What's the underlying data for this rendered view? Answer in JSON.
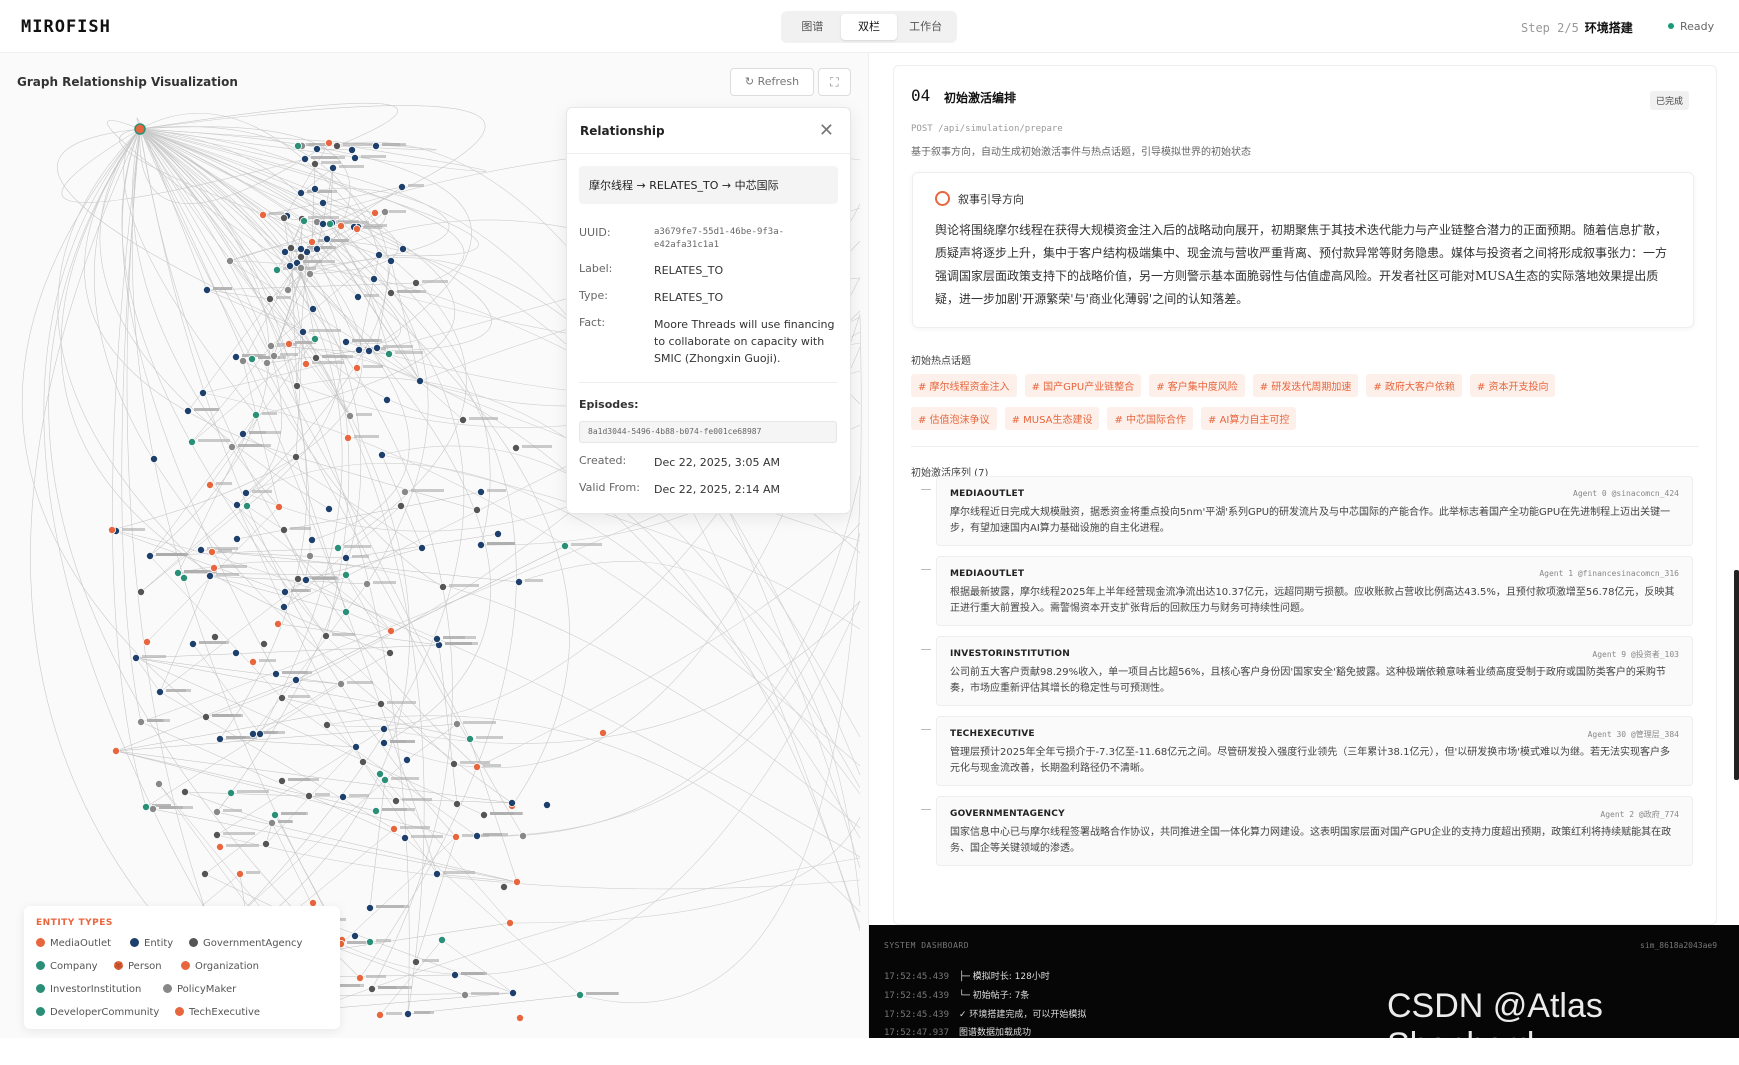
{
  "header": {
    "logo": "MIROFISH",
    "tabs": [
      {
        "label": "图谱",
        "active": false
      },
      {
        "label": "双栏",
        "active": true
      },
      {
        "label": "工作台",
        "active": false
      }
    ],
    "step_label": "Step 2/5",
    "step_name": "环境搭建",
    "status": "Ready"
  },
  "graph": {
    "title": "Graph Relationship Visualization",
    "refresh_label": "Refresh",
    "fullscreen_icon": "⛶"
  },
  "relationship": {
    "title": "Relationship",
    "path": "摩尔线程 → RELATES_TO → 中芯国际",
    "uuid_label": "UUID:",
    "uuid": "a3679fe7-55d1-46be-9f3a-e42afa31c1a1",
    "label_label": "Label:",
    "label": "RELATES_TO",
    "type_label": "Type:",
    "type": "RELATES_TO",
    "fact_label": "Fact:",
    "fact": "Moore Threads will use financing to collaborate on capacity with SMIC (Zhongxin Guoji).",
    "episodes_label": "Episodes:",
    "episode": "8a1d3044-5496-4b88-b074-fe001ce68987",
    "created_label": "Created:",
    "created": "Dec 22, 2025, 3:05 AM",
    "valid_label": "Valid From:",
    "valid": "Dec 22, 2025, 2:14 AM"
  },
  "legend": {
    "title": "ENTITY TYPES",
    "items": [
      {
        "label": "MediaOutlet",
        "color": "#e8663d"
      },
      {
        "label": "Entity",
        "color": "#1d3f6b"
      },
      {
        "label": "GovernmentAgency",
        "color": "#555555"
      },
      {
        "label": "Company",
        "color": "#2a8f77"
      },
      {
        "label": "Person",
        "color": "#c2502b"
      },
      {
        "label": "Organization",
        "color": "#e8663d"
      },
      {
        "label": "InvestorInstitution",
        "color": "#2a8f77"
      },
      {
        "label": "PolicyMaker",
        "color": "#888888"
      },
      {
        "label": "DeveloperCommunity",
        "color": "#2a8f77"
      },
      {
        "label": "TechExecutive",
        "color": "#e8663d"
      }
    ]
  },
  "panel": {
    "num": "04",
    "title": "初始激活编排",
    "badge": "已完成",
    "api": "POST /api/simulation/prepare",
    "desc": "基于叙事方向，自动生成初始激活事件与热点话题，引导模拟世界的初始状态",
    "narrative_title": "叙事引导方向",
    "narrative": "舆论将围绕摩尔线程在获得大规模资金注入后的战略动向展开，初期聚焦于其技术迭代能力与产业链整合潜力的正面预期。随着信息扩散，质疑声将逐步上升，集中于客户结构极端集中、现金流与营收严重背离、预付款异常等财务隐患。媒体与投资者之间将形成叙事张力：一方强调国家层面政策支持下的战略价值，另一方则警示基本面脆弱性与估值虚高风险。开发者社区可能对MUSA生态的实际落地效果提出质疑，进一步加剧'开源繁荣'与'商业化薄弱'之间的认知落差。",
    "hot_title": "初始热点话题",
    "tags": [
      "# 摩尔线程资金注入",
      "# 国产GPU产业链整合",
      "# 客户集中度风险",
      "# 研发迭代周期加速",
      "# 政府大客户依赖",
      "# 资本开支投向",
      "# 估值泡沫争议",
      "# MUSA生态建设",
      "# 中芯国际合作",
      "# AI算力自主可控"
    ],
    "seq_title": "初始激活序列 (7)",
    "posts": [
      {
        "type": "MEDIAOUTLET",
        "agent": "Agent 0 @sinacomcn_424",
        "text": "摩尔线程近日完成大规模融资，据悉资金将重点投向5nm'平湖'系列GPU的研发流片及与中芯国际的产能合作。此举标志着国产全功能GPU在先进制程上迈出关键一步，有望加速国内AI算力基础设施的自主化进程。"
      },
      {
        "type": "MEDIAOUTLET",
        "agent": "Agent 1 @financesinacomcn_316",
        "text": "根据最新披露，摩尔线程2025年上半年经营现金流净流出达10.37亿元，远超同期亏损额。应收账款占营收比例高达43.5%，且预付款项激增至56.78亿元，反映其正进行重大前置投入。需警惕资本开支扩张背后的回款压力与财务可持续性问题。"
      },
      {
        "type": "INVESTORINSTITUTION",
        "agent": "Agent 9 @投资者_103",
        "text": "公司前五大客户贡献98.29%收入，单一项目占比超56%，且核心客户身份因'国家安全'豁免披露。这种极端依赖意味着业绩高度受制于政府或国防类客户的采购节奏，市场应重新评估其增长的稳定性与可预测性。"
      },
      {
        "type": "TECHEXECUTIVE",
        "agent": "Agent 30 @管理层_384",
        "text": "管理层预计2025年全年亏损介于-7.3亿至-11.68亿元之间。尽管研发投入强度行业领先（三年累计38.1亿元），但'以研发换市场'模式难以为继。若无法实现客户多元化与现金流改善，长期盈利路径仍不清晰。"
      },
      {
        "type": "GOVERNMENTAGENCY",
        "agent": "Agent 2 @政府_774",
        "text": "国家信息中心已与摩尔线程签署战略合作协议，共同推进全国一体化算力网建设。这表明国家层面对国产GPU企业的支持力度超出预期，政策红利将持续赋能其在政务、国企等关键领域的渗透。"
      }
    ]
  },
  "system": {
    "title": "SYSTEM DASHBOARD",
    "session": "sim_8618a2043ae9",
    "logs": [
      {
        "ts": "17:52:45.439",
        "msg": "├─ 模拟时长: 128小时"
      },
      {
        "ts": "17:52:45.439",
        "msg": "└─ 初始帖子: 7条"
      },
      {
        "ts": "17:52:45.439",
        "msg": "✓ 环境搭建完成，可以开始模拟"
      },
      {
        "ts": "17:52:47.937",
        "msg": "图谱数据加载成功"
      }
    ]
  },
  "watermark": "CSDN @Atlas Shepherd",
  "colors": {
    "accent": "#e8663d",
    "dark_node": "#1d3f6b",
    "teal_node": "#2a8f77"
  }
}
